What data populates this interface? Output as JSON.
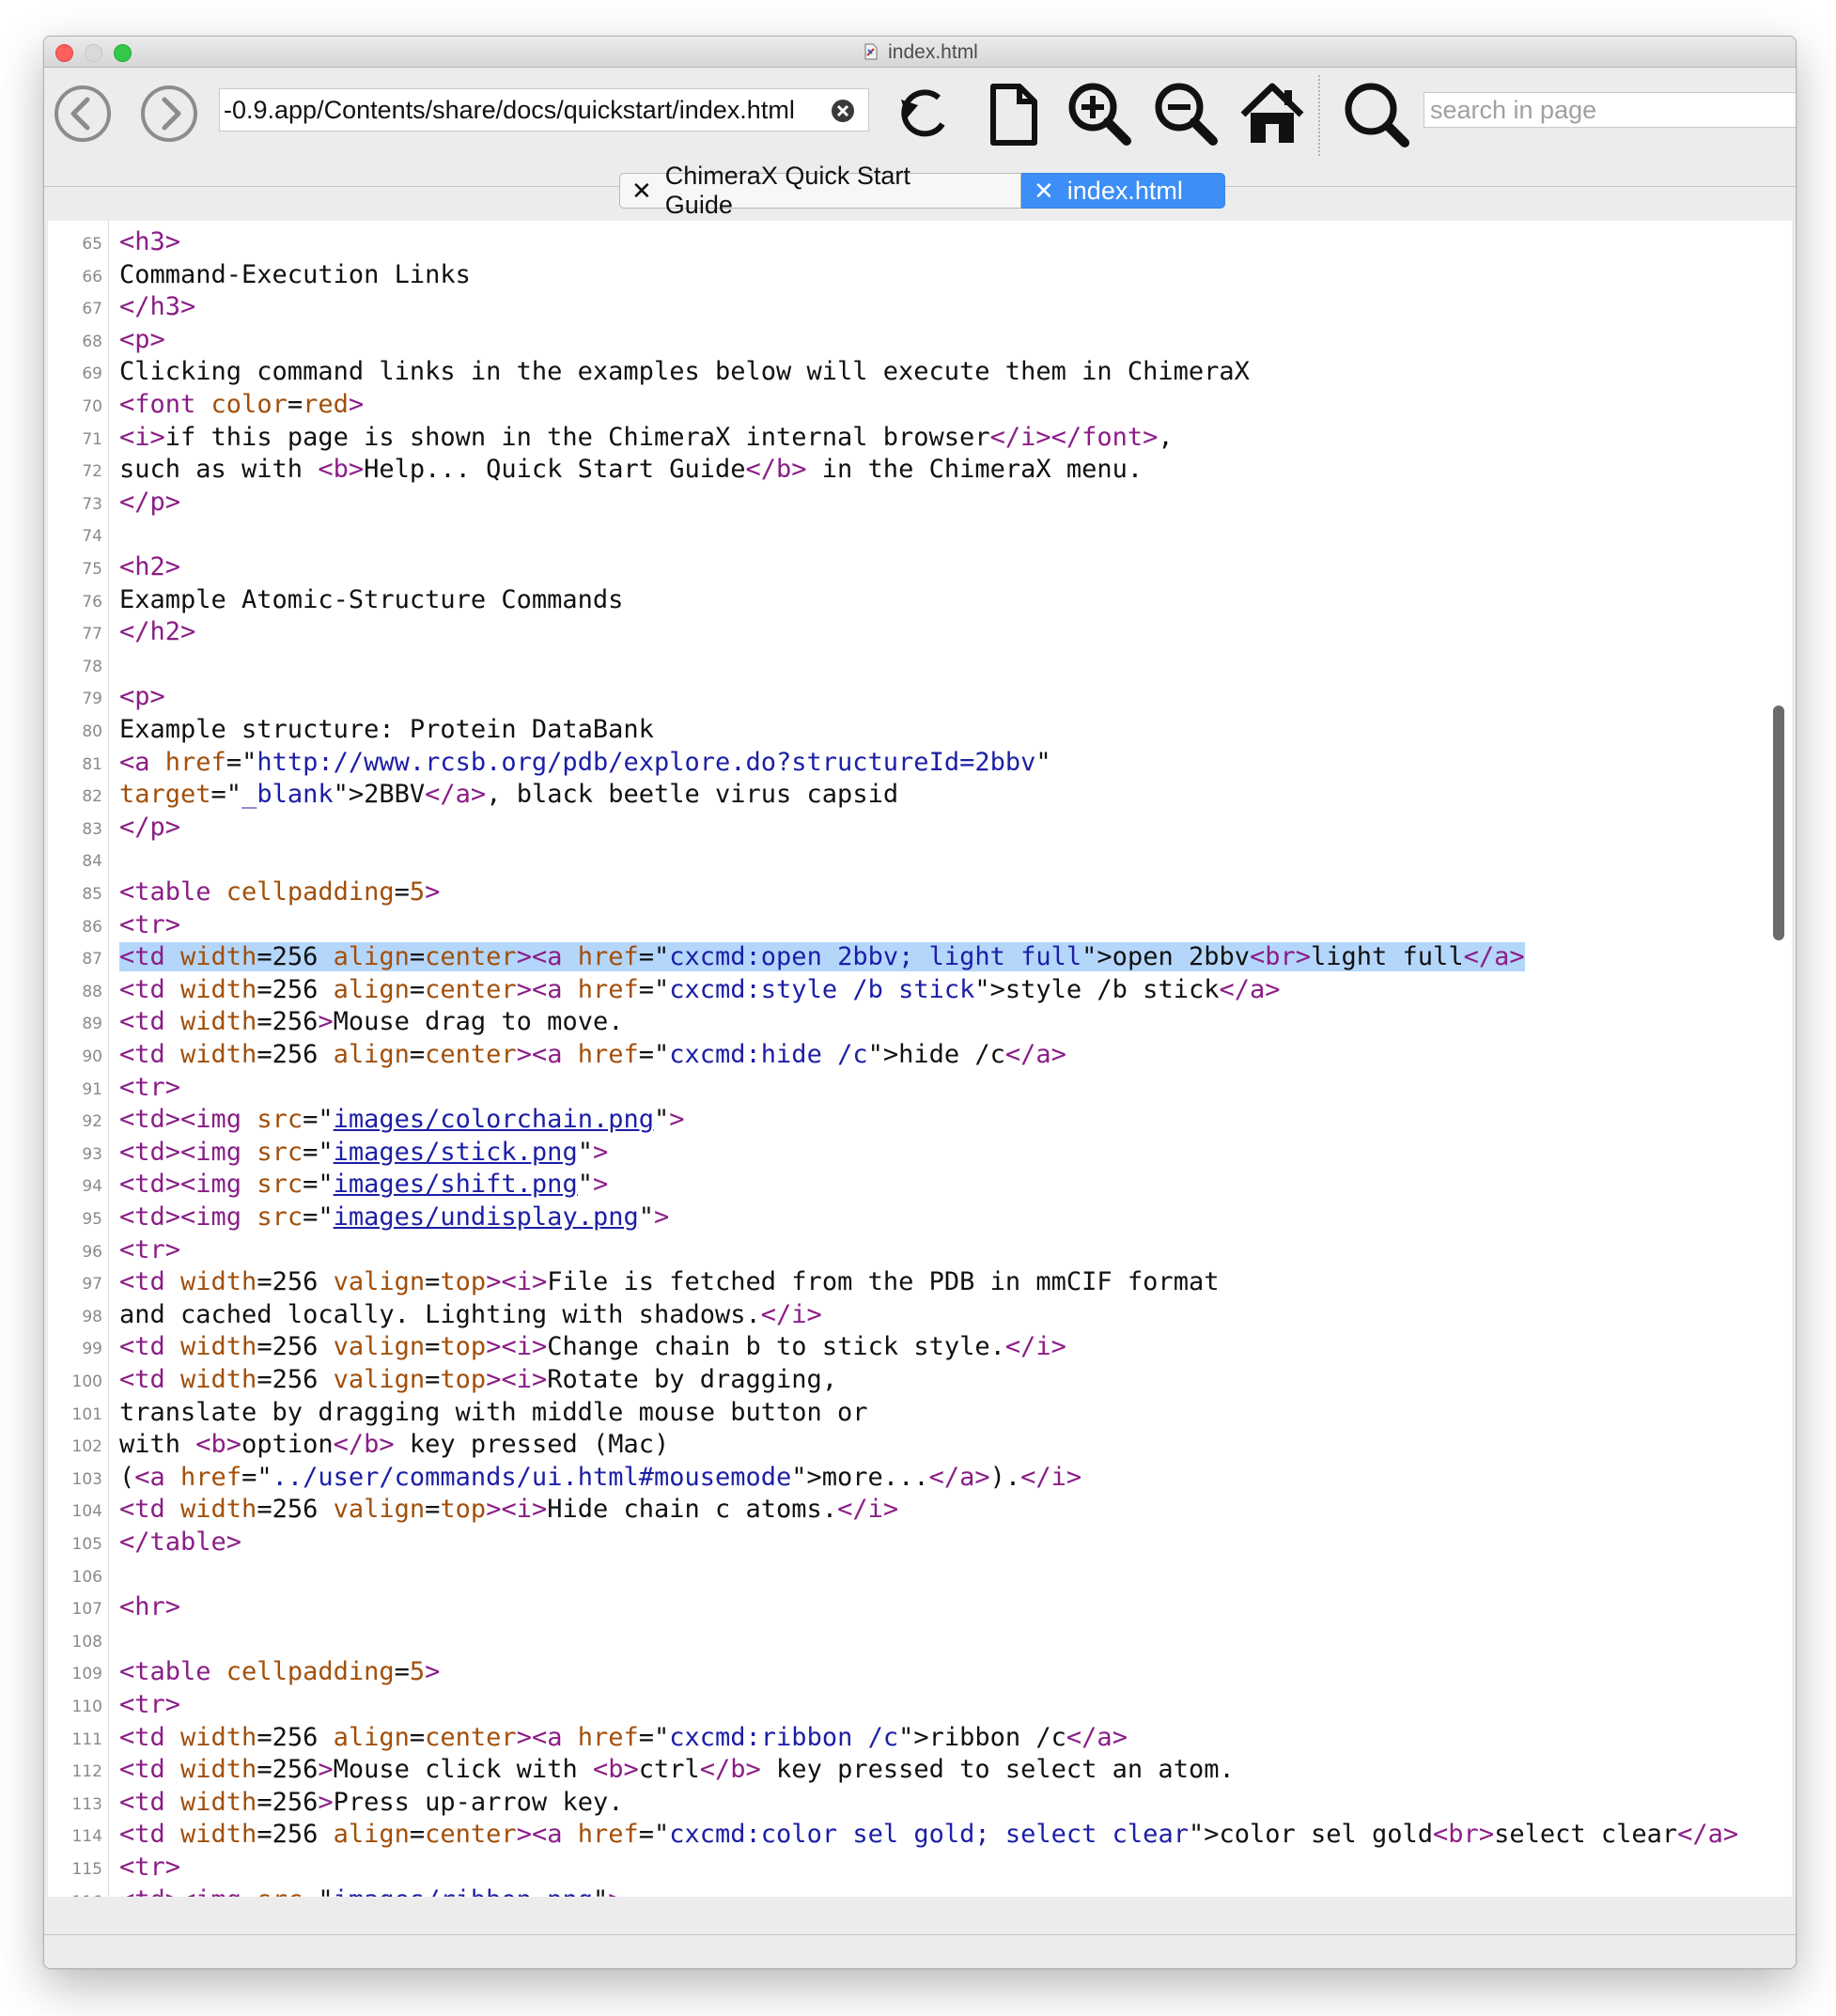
{
  "window": {
    "title": "index.html"
  },
  "toolbar": {
    "back": "back-button",
    "forward": "forward-button",
    "url": "-0.9.app/Contents/share/docs/quickstart/index.html",
    "search_placeholder": "search in page"
  },
  "tabs": [
    {
      "label": "ChimeraX Quick Start Guide",
      "active": false
    },
    {
      "label": "index.html",
      "active": true
    }
  ],
  "colors": {
    "tag": "#8b1d87",
    "attribute": "#a24f0a",
    "value": "#1c1ea6",
    "highlight": "#b4d6fb",
    "active_tab": "#3d8ef7"
  },
  "source": {
    "highlighted_line": 87,
    "lines": [
      {
        "n": "65",
        "t": [
          [
            "tag",
            "<h3>"
          ]
        ]
      },
      {
        "n": "66",
        "t": [
          [
            "text",
            "Command-Execution Links"
          ]
        ]
      },
      {
        "n": "67",
        "t": [
          [
            "tag",
            "</h3>"
          ]
        ]
      },
      {
        "n": "68",
        "t": [
          [
            "tag",
            "<p>"
          ]
        ]
      },
      {
        "n": "69",
        "t": [
          [
            "text",
            "Clicking command links in the examples below will execute them in ChimeraX"
          ]
        ]
      },
      {
        "n": "70",
        "t": [
          [
            "tag",
            "<font "
          ],
          [
            "attr",
            "color"
          ],
          [
            "text",
            "="
          ],
          [
            "attr",
            "red"
          ],
          [
            "tag",
            ">"
          ]
        ]
      },
      {
        "n": "71",
        "t": [
          [
            "tag",
            "<i>"
          ],
          [
            "text",
            "if this page is shown in the ChimeraX internal browser"
          ],
          [
            "tag",
            "</i></font>"
          ],
          [
            "text",
            ","
          ]
        ]
      },
      {
        "n": "72",
        "t": [
          [
            "text",
            "such as with "
          ],
          [
            "tag",
            "<b>"
          ],
          [
            "text",
            "Help... Quick Start Guide"
          ],
          [
            "tag",
            "</b>"
          ],
          [
            "text",
            " in the ChimeraX menu."
          ]
        ]
      },
      {
        "n": "73",
        "t": [
          [
            "tag",
            "</p>"
          ]
        ]
      },
      {
        "n": "74",
        "t": []
      },
      {
        "n": "75",
        "t": [
          [
            "tag",
            "<h2>"
          ]
        ]
      },
      {
        "n": "76",
        "t": [
          [
            "text",
            "Example Atomic-Structure Commands"
          ]
        ]
      },
      {
        "n": "77",
        "t": [
          [
            "tag",
            "</h2>"
          ]
        ]
      },
      {
        "n": "78",
        "t": []
      },
      {
        "n": "79",
        "t": [
          [
            "tag",
            "<p>"
          ]
        ]
      },
      {
        "n": "80",
        "t": [
          [
            "text",
            "Example structure: Protein DataBank"
          ]
        ]
      },
      {
        "n": "81",
        "t": [
          [
            "tag",
            "<a "
          ],
          [
            "attr",
            "href"
          ],
          [
            "text",
            "=\""
          ],
          [
            "val",
            "http://www.rcsb.org/pdb/explore.do?structureId=2bbv"
          ],
          [
            "text",
            "\""
          ]
        ]
      },
      {
        "n": "82",
        "t": [
          [
            "attr",
            "target"
          ],
          [
            "text",
            "=\""
          ],
          [
            "val",
            "_blank"
          ],
          [
            "text",
            "\">2BBV"
          ],
          [
            "tag",
            "</a>"
          ],
          [
            "text",
            ", black beetle virus capsid"
          ]
        ]
      },
      {
        "n": "83",
        "t": [
          [
            "tag",
            "</p>"
          ]
        ]
      },
      {
        "n": "84",
        "t": []
      },
      {
        "n": "85",
        "t": [
          [
            "tag",
            "<table "
          ],
          [
            "attr",
            "cellpadding"
          ],
          [
            "text",
            "="
          ],
          [
            "attr",
            "5"
          ],
          [
            "tag",
            ">"
          ]
        ]
      },
      {
        "n": "86",
        "t": [
          [
            "tag",
            "<tr>"
          ]
        ]
      },
      {
        "n": "87",
        "t": [
          [
            "tag",
            "<td "
          ],
          [
            "attr",
            "width"
          ],
          [
            "text",
            "=256 "
          ],
          [
            "attr",
            "align"
          ],
          [
            "text",
            "="
          ],
          [
            "attr",
            "center"
          ],
          [
            "tag",
            "><a "
          ],
          [
            "attr",
            "href"
          ],
          [
            "text",
            "=\""
          ],
          [
            "val",
            "cxcmd:open 2bbv; light full"
          ],
          [
            "text",
            "\">open 2bbv"
          ],
          [
            "tag",
            "<br>"
          ],
          [
            "text",
            "light full"
          ],
          [
            "tag",
            "</a>"
          ]
        ]
      },
      {
        "n": "88",
        "t": [
          [
            "tag",
            "<td "
          ],
          [
            "attr",
            "width"
          ],
          [
            "text",
            "=256 "
          ],
          [
            "attr",
            "align"
          ],
          [
            "text",
            "="
          ],
          [
            "attr",
            "center"
          ],
          [
            "tag",
            "><a "
          ],
          [
            "attr",
            "href"
          ],
          [
            "text",
            "=\""
          ],
          [
            "val",
            "cxcmd:style /b stick"
          ],
          [
            "text",
            "\">style /b stick"
          ],
          [
            "tag",
            "</a>"
          ]
        ]
      },
      {
        "n": "89",
        "t": [
          [
            "tag",
            "<td "
          ],
          [
            "attr",
            "width"
          ],
          [
            "text",
            "=256"
          ],
          [
            "tag",
            ">"
          ],
          [
            "text",
            "Mouse drag to move."
          ]
        ]
      },
      {
        "n": "90",
        "t": [
          [
            "tag",
            "<td "
          ],
          [
            "attr",
            "width"
          ],
          [
            "text",
            "=256 "
          ],
          [
            "attr",
            "align"
          ],
          [
            "text",
            "="
          ],
          [
            "attr",
            "center"
          ],
          [
            "tag",
            "><a "
          ],
          [
            "attr",
            "href"
          ],
          [
            "text",
            "=\""
          ],
          [
            "val",
            "cxcmd:hide /c"
          ],
          [
            "text",
            "\">hide /c"
          ],
          [
            "tag",
            "</a>"
          ]
        ]
      },
      {
        "n": "91",
        "t": [
          [
            "tag",
            "<tr>"
          ]
        ]
      },
      {
        "n": "92",
        "t": [
          [
            "tag",
            "<td><img "
          ],
          [
            "attr",
            "src"
          ],
          [
            "text",
            "=\""
          ],
          [
            "link",
            "images/colorchain.png"
          ],
          [
            "text",
            "\""
          ],
          [
            "tag",
            ">"
          ]
        ]
      },
      {
        "n": "93",
        "t": [
          [
            "tag",
            "<td><img "
          ],
          [
            "attr",
            "src"
          ],
          [
            "text",
            "=\""
          ],
          [
            "link",
            "images/stick.png"
          ],
          [
            "text",
            "\""
          ],
          [
            "tag",
            ">"
          ]
        ]
      },
      {
        "n": "94",
        "t": [
          [
            "tag",
            "<td><img "
          ],
          [
            "attr",
            "src"
          ],
          [
            "text",
            "=\""
          ],
          [
            "link",
            "images/shift.png"
          ],
          [
            "text",
            "\""
          ],
          [
            "tag",
            ">"
          ]
        ]
      },
      {
        "n": "95",
        "t": [
          [
            "tag",
            "<td><img "
          ],
          [
            "attr",
            "src"
          ],
          [
            "text",
            "=\""
          ],
          [
            "link",
            "images/undisplay.png"
          ],
          [
            "text",
            "\""
          ],
          [
            "tag",
            ">"
          ]
        ]
      },
      {
        "n": "96",
        "t": [
          [
            "tag",
            "<tr>"
          ]
        ]
      },
      {
        "n": "97",
        "t": [
          [
            "tag",
            "<td "
          ],
          [
            "attr",
            "width"
          ],
          [
            "text",
            "=256 "
          ],
          [
            "attr",
            "valign"
          ],
          [
            "text",
            "="
          ],
          [
            "attr",
            "top"
          ],
          [
            "tag",
            "><i>"
          ],
          [
            "text",
            "File is fetched from the PDB in mmCIF format"
          ]
        ]
      },
      {
        "n": "98",
        "t": [
          [
            "text",
            "and cached locally. Lighting with shadows."
          ],
          [
            "tag",
            "</i>"
          ]
        ]
      },
      {
        "n": "99",
        "t": [
          [
            "tag",
            "<td "
          ],
          [
            "attr",
            "width"
          ],
          [
            "text",
            "=256 "
          ],
          [
            "attr",
            "valign"
          ],
          [
            "text",
            "="
          ],
          [
            "attr",
            "top"
          ],
          [
            "tag",
            "><i>"
          ],
          [
            "text",
            "Change chain b to stick style."
          ],
          [
            "tag",
            "</i>"
          ]
        ]
      },
      {
        "n": "100",
        "t": [
          [
            "tag",
            "<td "
          ],
          [
            "attr",
            "width"
          ],
          [
            "text",
            "=256 "
          ],
          [
            "attr",
            "valign"
          ],
          [
            "text",
            "="
          ],
          [
            "attr",
            "top"
          ],
          [
            "tag",
            "><i>"
          ],
          [
            "text",
            "Rotate by dragging,"
          ]
        ]
      },
      {
        "n": "101",
        "t": [
          [
            "text",
            "translate by dragging with middle mouse button or"
          ]
        ]
      },
      {
        "n": "102",
        "t": [
          [
            "text",
            "with "
          ],
          [
            "tag",
            "<b>"
          ],
          [
            "text",
            "option"
          ],
          [
            "tag",
            "</b>"
          ],
          [
            "text",
            " key pressed (Mac)"
          ]
        ]
      },
      {
        "n": "103",
        "t": [
          [
            "text",
            "("
          ],
          [
            "tag",
            "<a "
          ],
          [
            "attr",
            "href"
          ],
          [
            "text",
            "=\""
          ],
          [
            "val",
            "../user/commands/ui.html#mousemode"
          ],
          [
            "text",
            "\">more..."
          ],
          [
            "tag",
            "</a>"
          ],
          [
            "text",
            ")."
          ],
          [
            "tag",
            "</i>"
          ]
        ]
      },
      {
        "n": "104",
        "t": [
          [
            "tag",
            "<td "
          ],
          [
            "attr",
            "width"
          ],
          [
            "text",
            "=256 "
          ],
          [
            "attr",
            "valign"
          ],
          [
            "text",
            "="
          ],
          [
            "attr",
            "top"
          ],
          [
            "tag",
            "><i>"
          ],
          [
            "text",
            "Hide chain c atoms."
          ],
          [
            "tag",
            "</i>"
          ]
        ]
      },
      {
        "n": "105",
        "t": [
          [
            "tag",
            "</table>"
          ]
        ]
      },
      {
        "n": "106",
        "t": []
      },
      {
        "n": "107",
        "t": [
          [
            "tag",
            "<hr>"
          ]
        ]
      },
      {
        "n": "108",
        "t": []
      },
      {
        "n": "109",
        "t": [
          [
            "tag",
            "<table "
          ],
          [
            "attr",
            "cellpadding"
          ],
          [
            "text",
            "="
          ],
          [
            "attr",
            "5"
          ],
          [
            "tag",
            ">"
          ]
        ]
      },
      {
        "n": "110",
        "t": [
          [
            "tag",
            "<tr>"
          ]
        ]
      },
      {
        "n": "111",
        "t": [
          [
            "tag",
            "<td "
          ],
          [
            "attr",
            "width"
          ],
          [
            "text",
            "=256 "
          ],
          [
            "attr",
            "align"
          ],
          [
            "text",
            "="
          ],
          [
            "attr",
            "center"
          ],
          [
            "tag",
            "><a "
          ],
          [
            "attr",
            "href"
          ],
          [
            "text",
            "=\""
          ],
          [
            "val",
            "cxcmd:ribbon /c"
          ],
          [
            "text",
            "\">ribbon /c"
          ],
          [
            "tag",
            "</a>"
          ]
        ]
      },
      {
        "n": "112",
        "t": [
          [
            "tag",
            "<td "
          ],
          [
            "attr",
            "width"
          ],
          [
            "text",
            "=256"
          ],
          [
            "tag",
            ">"
          ],
          [
            "text",
            "Mouse click with "
          ],
          [
            "tag",
            "<b>"
          ],
          [
            "text",
            "ctrl"
          ],
          [
            "tag",
            "</b>"
          ],
          [
            "text",
            " key pressed to select an atom."
          ]
        ]
      },
      {
        "n": "113",
        "t": [
          [
            "tag",
            "<td "
          ],
          [
            "attr",
            "width"
          ],
          [
            "text",
            "=256"
          ],
          [
            "tag",
            ">"
          ],
          [
            "text",
            "Press up-arrow key."
          ]
        ]
      },
      {
        "n": "114",
        "t": [
          [
            "tag",
            "<td "
          ],
          [
            "attr",
            "width"
          ],
          [
            "text",
            "=256 "
          ],
          [
            "attr",
            "align"
          ],
          [
            "text",
            "="
          ],
          [
            "attr",
            "center"
          ],
          [
            "tag",
            "><a "
          ],
          [
            "attr",
            "href"
          ],
          [
            "text",
            "=\""
          ],
          [
            "val",
            "cxcmd:color sel gold; select clear"
          ],
          [
            "text",
            "\">color sel gold"
          ],
          [
            "tag",
            "<br>"
          ],
          [
            "text",
            "select clear"
          ],
          [
            "tag",
            "</a>"
          ]
        ]
      },
      {
        "n": "115",
        "t": [
          [
            "tag",
            "<tr>"
          ]
        ]
      },
      {
        "n": "116",
        "t": [
          [
            "tag",
            "<td><img "
          ],
          [
            "attr",
            "src"
          ],
          [
            "text",
            "=\""
          ],
          [
            "link",
            "images/ribbon.png"
          ],
          [
            "text",
            "\""
          ],
          [
            "tag",
            ">"
          ]
        ]
      }
    ]
  }
}
